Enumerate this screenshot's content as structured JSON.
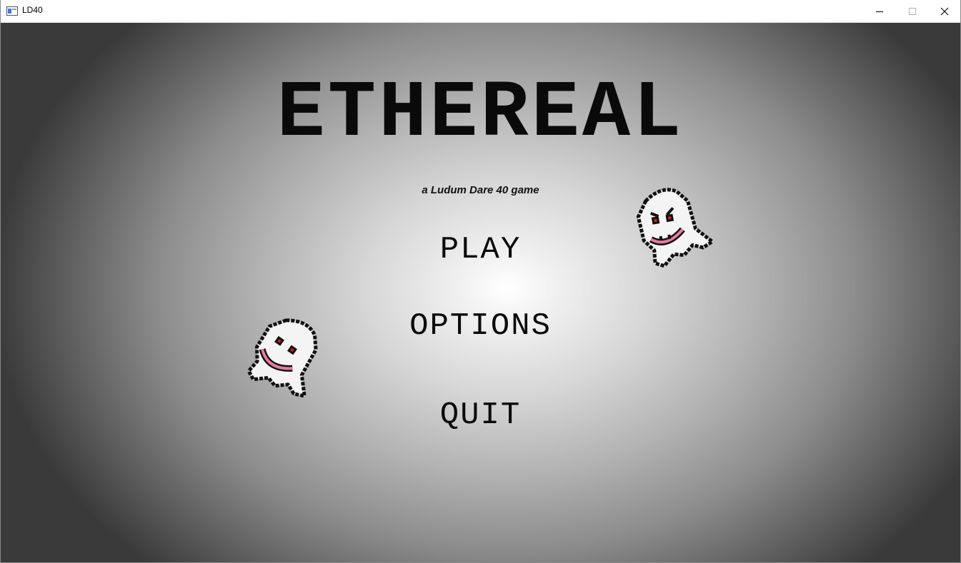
{
  "window": {
    "title": "LD40"
  },
  "game": {
    "title": "ETHEREAL",
    "subtitle": "a Ludum Dare 40 game",
    "menu": {
      "play": "PLAY",
      "options": "OPTIONS",
      "quit": "QUIT"
    }
  },
  "icons": [
    "app-icon",
    "minimize-icon",
    "maximize-icon",
    "close-icon",
    "ghost-sprite"
  ],
  "colors": {
    "ghost_eye": "#d21d1d",
    "ghost_mouth": "#e87aa0",
    "title_text": "#0a0a0a"
  }
}
